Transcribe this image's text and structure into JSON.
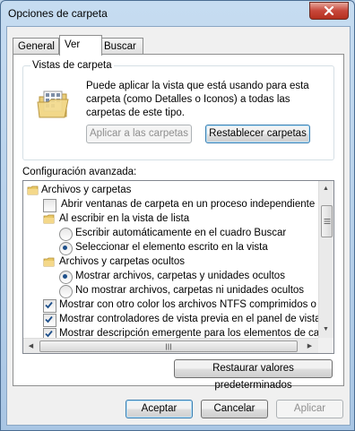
{
  "window": {
    "title": "Opciones de carpeta"
  },
  "tabs": [
    {
      "label": "General",
      "active": false
    },
    {
      "label": "Ver",
      "active": true
    },
    {
      "label": "Buscar",
      "active": false
    }
  ],
  "folder_views": {
    "group_label": "Vistas de carpeta",
    "description": "Puede aplicar la vista que está usando para esta carpeta (como Detalles o Iconos) a todas las carpetas de este tipo.",
    "apply_button": "Aplicar a las carpetas",
    "reset_button": "Restablecer carpetas"
  },
  "advanced": {
    "label": "Configuración avanzada:",
    "items": [
      {
        "type": "folder",
        "text": "Archivos y carpetas"
      },
      {
        "type": "checkbox",
        "checked": false,
        "text": "Abrir ventanas de carpeta  en un proceso independiente"
      },
      {
        "type": "folder",
        "text": "Al escribir en la vista de lista"
      },
      {
        "type": "radio",
        "checked": false,
        "text": "Escribir automáticamente en el cuadro Buscar"
      },
      {
        "type": "radio",
        "checked": true,
        "text": "Seleccionar el elemento escrito en la vista"
      },
      {
        "type": "folder",
        "text": "Archivos y carpetas ocultos"
      },
      {
        "type": "radio",
        "checked": true,
        "text": "Mostrar archivos, carpetas y unidades ocultos"
      },
      {
        "type": "radio",
        "checked": false,
        "text": "No mostrar archivos, carpetas ni unidades ocultos"
      },
      {
        "type": "checkbox",
        "checked": true,
        "text": "Mostrar con otro color los archivos NTFS comprimidos o c"
      },
      {
        "type": "checkbox",
        "checked": true,
        "text": "Mostrar controladores de vista previa en el panel de vista"
      },
      {
        "type": "checkbox",
        "checked": true,
        "text": "Mostrar descripción emergente para los elementos de car"
      }
    ]
  },
  "restore_button": "Restaurar valores predeterminados",
  "footer": {
    "ok": "Aceptar",
    "cancel": "Cancelar",
    "apply": "Aplicar"
  },
  "colors": {
    "title_bar": "#b9d1ea",
    "close_button": "#c7473a",
    "panel": "#ffffff",
    "dialog": "#f0f0f0"
  }
}
